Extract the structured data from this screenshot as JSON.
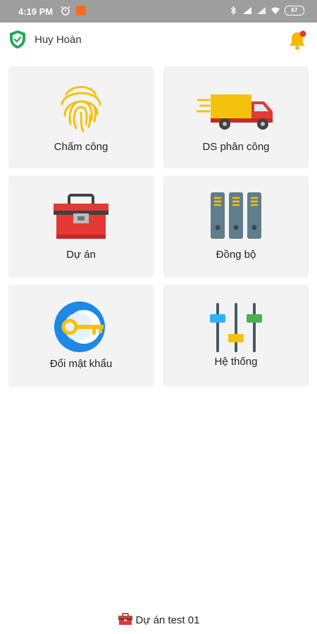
{
  "status_bar": {
    "time": "4:19 PM",
    "battery": "67",
    "icons": [
      "alarm-icon",
      "notification-app-icon",
      "bluetooth-icon",
      "signal-icon",
      "signal-icon",
      "wifi-icon",
      "battery-icon"
    ]
  },
  "header": {
    "username": "Huy Hoàn",
    "shield_icon": "shield-check-icon",
    "bell_icon": "bell-icon"
  },
  "menu": [
    {
      "label": "Chấm công",
      "icon": "fingerprint-icon"
    },
    {
      "label": "DS phân công",
      "icon": "delivery-truck-icon"
    },
    {
      "label": "Dự án",
      "icon": "toolbox-icon"
    },
    {
      "label": "Đồng bộ",
      "icon": "server-binders-icon"
    },
    {
      "label": "Đổi mật khẩu",
      "icon": "key-icon"
    },
    {
      "label": "Hệ thống",
      "icon": "sliders-icon"
    }
  ],
  "footer": {
    "project": "Dự án test 01",
    "icon": "toolbox-icon"
  },
  "colors": {
    "status_bar": "#9e9e9e",
    "tile": "#f3f3f3",
    "accent_green": "#26a65b",
    "bell": "#f5b800",
    "badge": "#e53935"
  }
}
